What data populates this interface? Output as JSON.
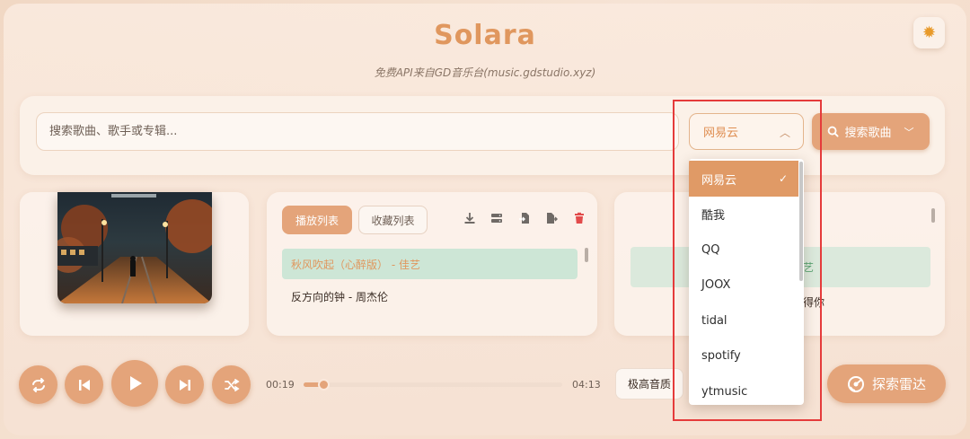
{
  "app": {
    "title": "Solara",
    "subtitle": "免费API来自GD音乐台(music.gdstudio.xyz)"
  },
  "search": {
    "placeholder": "搜索歌曲、歌手或专辑...",
    "source_selected": "网易云",
    "button_label": "搜索歌曲"
  },
  "source_dropdown": {
    "options": [
      "网易云",
      "酷我",
      "QQ",
      "JOOX",
      "tidal",
      "spotify",
      "ytmusic"
    ],
    "selected_index": 0
  },
  "playlist": {
    "tabs": [
      "播放列表",
      "收藏列表"
    ],
    "active_tab": 0,
    "tools": [
      "download-icon",
      "storage-icon",
      "import-icon",
      "export-icon",
      "trash-icon"
    ],
    "songs": [
      "秋风吹起（心醉版） - 佳艺",
      "反方向的钟 - 周杰伦"
    ],
    "active_song": 0
  },
  "lyrics": {
    "visible_fragments": [
      "艺",
      "得你"
    ]
  },
  "player": {
    "current_time": "00:19",
    "duration": "04:13",
    "progress_fraction": 0.075,
    "quality_label": "极高音质",
    "radar_label": "探索雷达"
  },
  "colors": {
    "accent": "#e4a47a",
    "title": "#e0975e",
    "active_song_bg": "#cde6d6",
    "highlight_box": "#e53b3b"
  }
}
